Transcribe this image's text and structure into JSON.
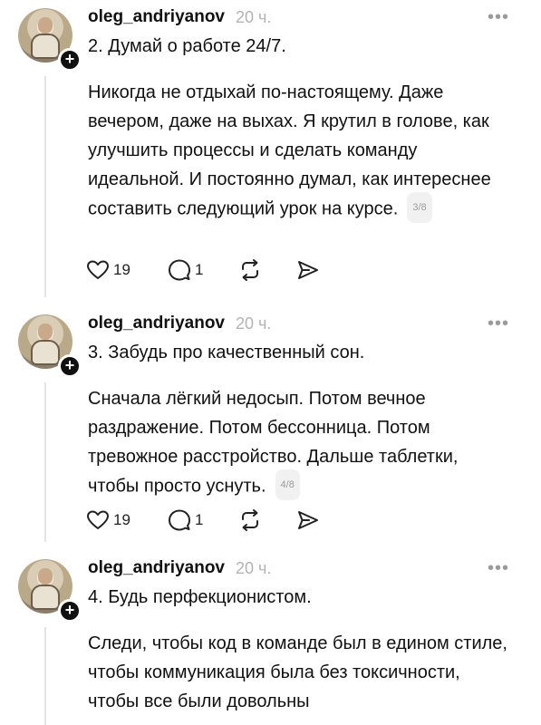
{
  "posts": [
    {
      "username": "oleg_andriyanov",
      "time": "20 ч.",
      "heading": "2. Думай о работе 24/7.",
      "text": "Никогда не отдыхай по-настоящему. Даже вечером, даже на выхах. Я крутил в голове, как улучшить процессы и сделать команду идеальной. И постоянно думал, как интереснее составить следующий урок на курсе.",
      "pager": "3/8",
      "likes": "19",
      "replies": "1"
    },
    {
      "username": "oleg_andriyanov",
      "time": "20 ч.",
      "heading": "3. Забудь про качественный сон.",
      "text": "Сначала лёгкий недосып. Потом вечное раздражение. Потом бессонница. Потом тревожное расстройство. Дальше таблетки, чтобы просто уснуть.",
      "pager": "4/8",
      "likes": "19",
      "replies": "1"
    },
    {
      "username": "oleg_andriyanov",
      "time": "20 ч.",
      "heading": "4. Будь перфекционистом.",
      "text": "Следи, чтобы код в команде был в едином стиле, чтобы коммуникация была без токсичности, чтобы все были довольны"
    }
  ],
  "icons": {
    "more": "more-icon",
    "like": "heart-icon",
    "reply": "comment-icon",
    "repost": "repost-icon",
    "share": "share-icon",
    "follow": "plus-icon"
  },
  "colors": {
    "text": "#111111",
    "muted": "#b3b3b3",
    "thread": "#e3e3e3"
  }
}
